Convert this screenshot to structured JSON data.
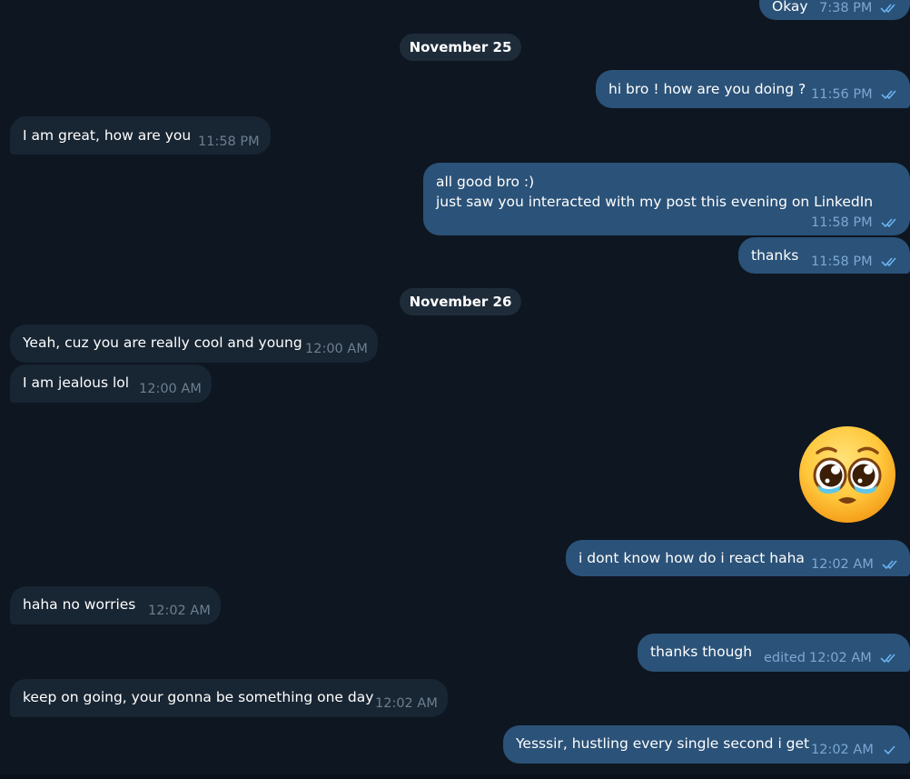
{
  "messages": [
    {
      "id": "m0",
      "text": "Okay",
      "time": "7:38 PM",
      "status": "read"
    },
    {
      "id": "m1",
      "text": "hi bro ! how are you doing ?",
      "time": "11:56 PM",
      "status": "read"
    },
    {
      "id": "m2",
      "text": "I am great, how are you",
      "time": "11:58 PM"
    },
    {
      "id": "m3",
      "line1": "all good bro :)",
      "line2": "just saw you interacted with my post this evening on LinkedIn",
      "time": "11:58 PM",
      "status": "read"
    },
    {
      "id": "m4",
      "text": "thanks",
      "time": "11:58 PM",
      "status": "read"
    },
    {
      "id": "m5",
      "text": "Yeah, cuz you are really cool and young",
      "time": "12:00 AM"
    },
    {
      "id": "m6",
      "text": "I am jealous lol",
      "time": "12:00 AM"
    },
    {
      "id": "m7",
      "emoji": "pleading-face",
      "emoji_char": "🥺"
    },
    {
      "id": "m8",
      "text": "i dont know how do i react haha",
      "time": "12:02 AM",
      "status": "read"
    },
    {
      "id": "m9",
      "text": "haha no worries",
      "time": "12:02 AM"
    },
    {
      "id": "m10",
      "text": "thanks though",
      "edited_label": "edited",
      "time": "12:02 AM",
      "status": "read"
    },
    {
      "id": "m11",
      "text": "keep on going, your gonna be something one day",
      "time": "12:02 AM"
    },
    {
      "id": "m12",
      "text": "Yesssir, hustling every single second i get",
      "time": "12:02 AM",
      "status": "sent"
    }
  ],
  "dates": {
    "d1": "November 25",
    "d2": "November 26"
  },
  "colors": {
    "background": "#0e1621",
    "incoming_bubble": "#182533",
    "outgoing_bubble": "#2b5278",
    "incoming_meta": "#6d7f8f",
    "outgoing_meta": "#7da8d3",
    "date_pill": "#1e2c3a"
  }
}
